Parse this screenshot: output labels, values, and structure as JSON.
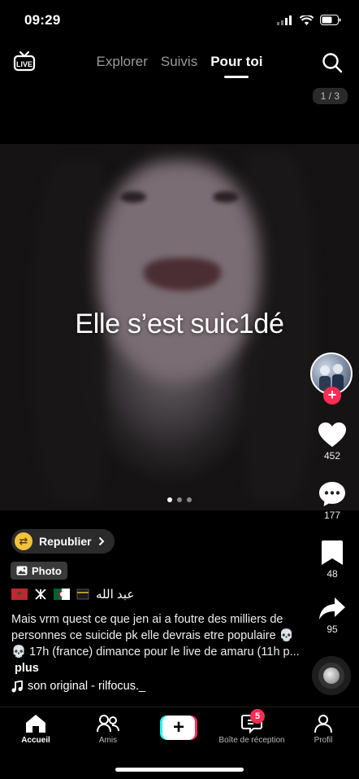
{
  "status_bar": {
    "time": "09:29"
  },
  "top_nav": {
    "tabs": [
      {
        "label": "Explorer",
        "active": false
      },
      {
        "label": "Suivis",
        "active": false
      },
      {
        "label": "Pour toi",
        "active": true
      }
    ],
    "page_counter": "1 / 3"
  },
  "post": {
    "overlay_text": "Elle s’est suic1dé",
    "carousel": {
      "count": 3,
      "active": 1
    },
    "republish_label": "Republier",
    "type_tag": "Photo",
    "flags_text": "عبد الله",
    "caption": "Mais vrm quest ce que jen ai a foutre des milliers de personnes ce suicide pk elle devrais etre populaire 💀💀 17h (france) dimance pour le live de amaru (11h p...",
    "caption_more": "plus",
    "sound": "son original - rilfocus._"
  },
  "actions": {
    "likes": "452",
    "comments": "177",
    "saves": "48",
    "shares": "95"
  },
  "bottom_nav": {
    "items": [
      {
        "label": "Accueil",
        "icon": "home-icon",
        "active": true
      },
      {
        "label": "Amis",
        "icon": "friends-icon",
        "active": false
      },
      {
        "label": "",
        "icon": "create-icon",
        "active": false
      },
      {
        "label": "Boîte de réception",
        "icon": "inbox-icon",
        "active": false,
        "badge": "5"
      },
      {
        "label": "Profil",
        "icon": "profile-icon",
        "active": false
      }
    ]
  },
  "colors": {
    "accent": "#fe2c55",
    "secondary": "#25f4ee",
    "background": "#000000"
  }
}
